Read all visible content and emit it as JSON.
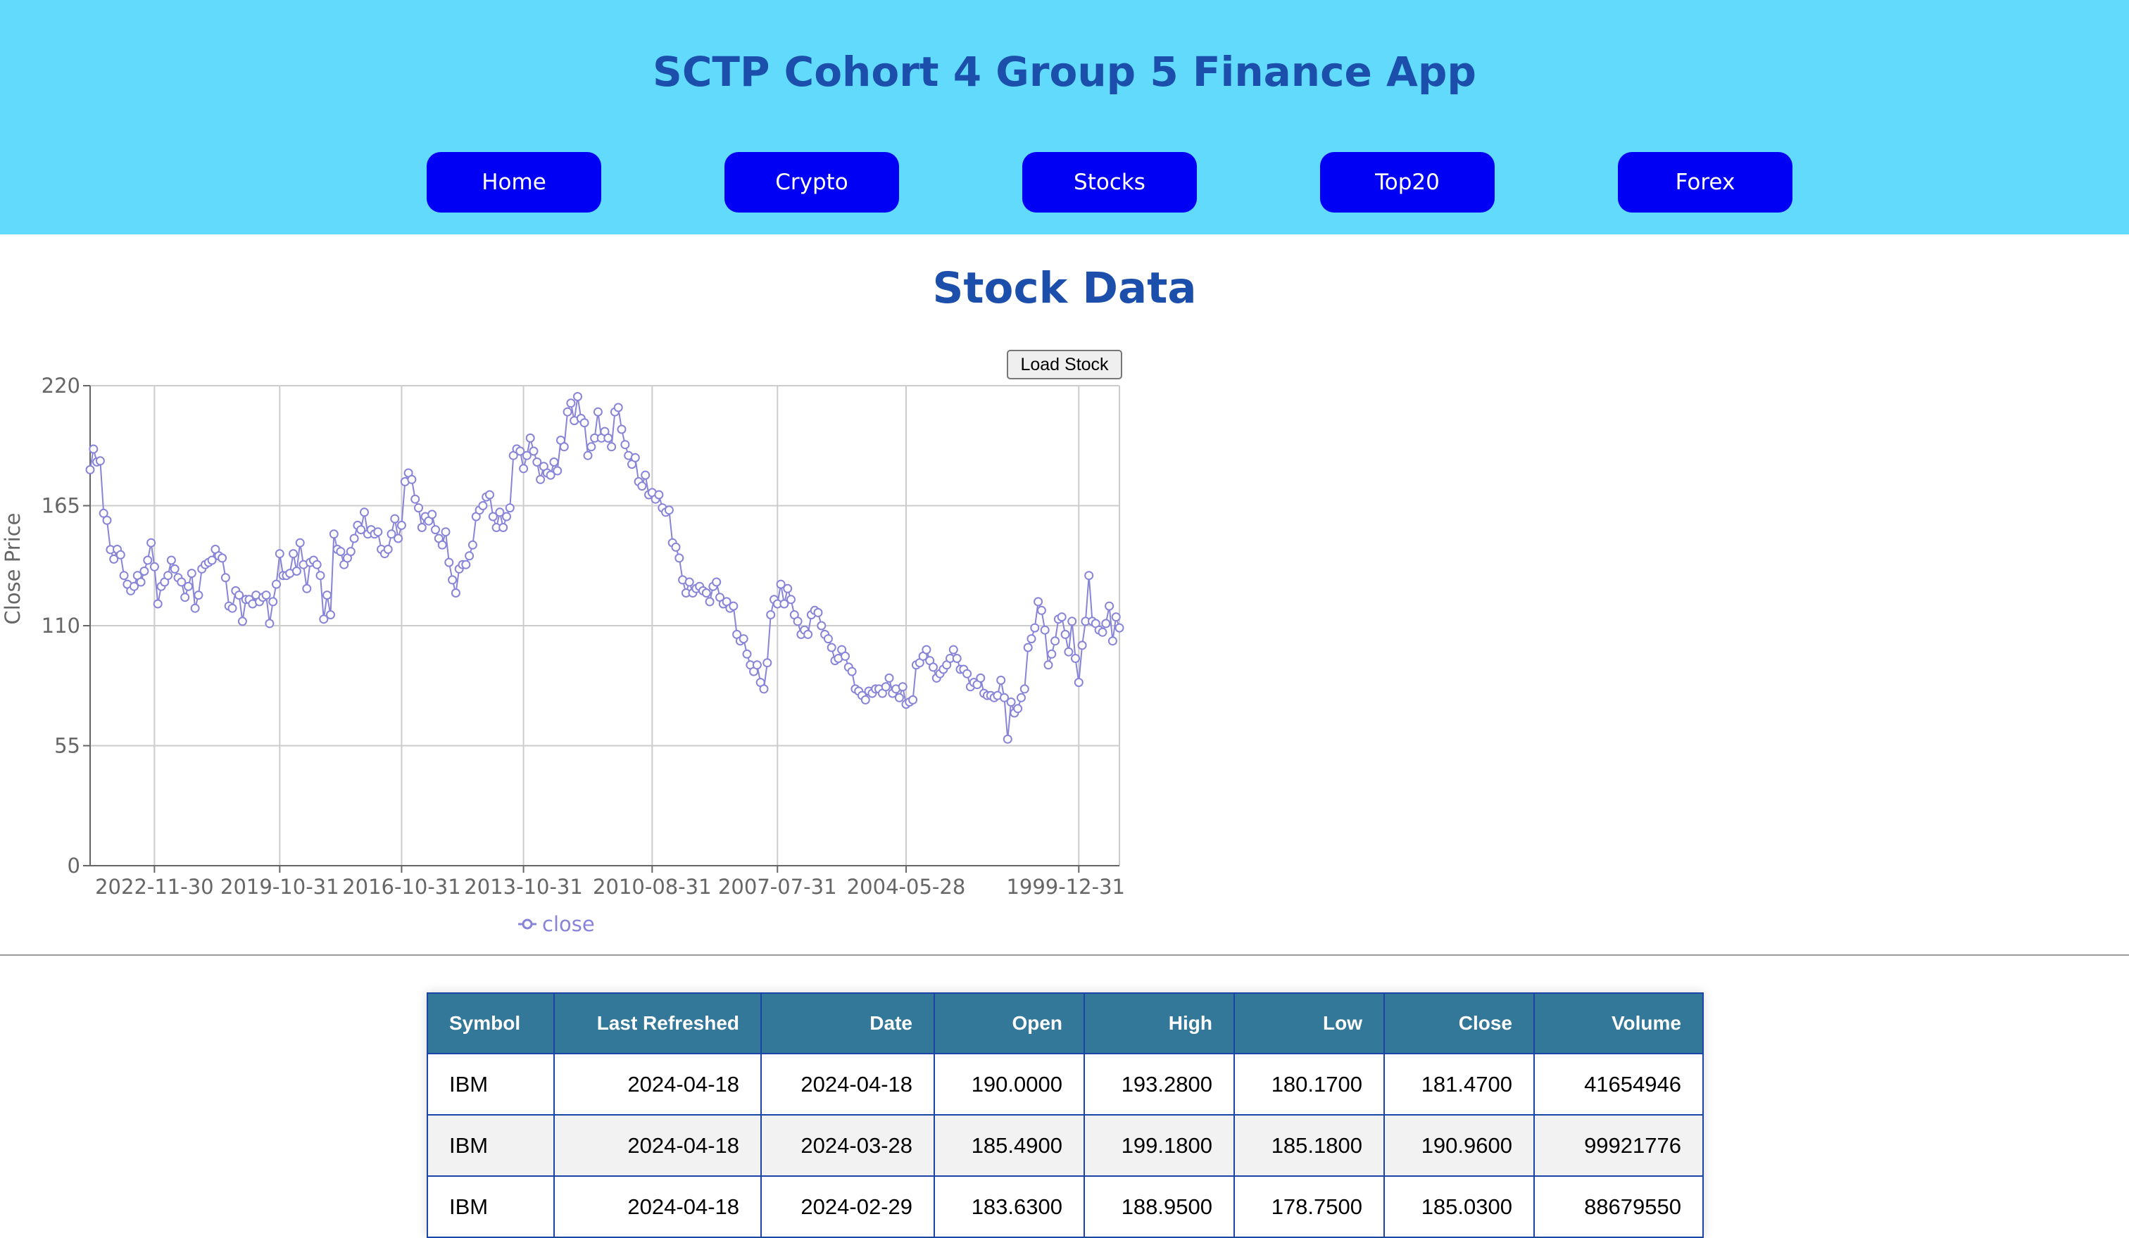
{
  "header": {
    "title": "SCTP Cohort 4 Group 5 Finance App",
    "bg_color": "#61dafb",
    "title_color": "#1b4fab"
  },
  "nav": {
    "button_color": "#0000f5",
    "items": [
      {
        "label": "Home"
      },
      {
        "label": "Crypto"
      },
      {
        "label": "Stocks"
      },
      {
        "label": "Top20"
      },
      {
        "label": "Forex"
      }
    ]
  },
  "page": {
    "title": "Stock Data",
    "load_button": "Load Stock"
  },
  "chart_data": {
    "type": "line",
    "ylabel": "Close Price",
    "xlabel": "",
    "ylim": [
      0,
      220
    ],
    "yticks": [
      0,
      55,
      110,
      165,
      220
    ],
    "x_order": "newest-first",
    "xticks": [
      "2022-11-30",
      "2019-10-31",
      "2016-10-31",
      "2013-10-31",
      "2010-08-31",
      "2007-07-31",
      "2004-05-28",
      "1999-12-31"
    ],
    "grid": true,
    "legend": "bottom-center",
    "series": [
      {
        "name": "close",
        "color": "#8884d8",
        "values": [
          181.47,
          190.96,
          185.03,
          185.54,
          161.5,
          158.3,
          144.87,
          140.5,
          145.0,
          142.5,
          133.0,
          129.0,
          126.0,
          128.0,
          133.0,
          130.0,
          135.0,
          140.0,
          148.0,
          137.0,
          120.0,
          128.0,
          130.0,
          133.0,
          140.0,
          136.0,
          132.0,
          130.0,
          123.0,
          128.0,
          134.0,
          118.0,
          124.0,
          136.0,
          138.0,
          139.0,
          140.0,
          145.0,
          142.0,
          141.0,
          132.0,
          119.0,
          118.0,
          126.0,
          124.0,
          112.0,
          122.0,
          122.0,
          120.0,
          124.0,
          121.0,
          123.0,
          124.0,
          111.0,
          121.0,
          129.0,
          143.0,
          133.0,
          133.0,
          134.0,
          143.0,
          135.0,
          148.0,
          138.0,
          127.0,
          139.0,
          140.0,
          138.0,
          133.0,
          113.0,
          124.0,
          115.0,
          152.0,
          145.0,
          144.0,
          138.0,
          141.0,
          144.0,
          150.0,
          156.0,
          154.0,
          162.0,
          152.0,
          154.0,
          152.0,
          153.0,
          145.0,
          143.0,
          145.0,
          152.0,
          159.0,
          150.0,
          156.0,
          176.0,
          180.0,
          177.0,
          168.0,
          164.0,
          155.0,
          160.0,
          158.0,
          161.0,
          154.0,
          150.0,
          147.0,
          153.0,
          139.0,
          131.0,
          125.0,
          136.0,
          138.0,
          138.0,
          142.0,
          147.0,
          160.0,
          163.0,
          165.0,
          169.0,
          170.0,
          160.0,
          155.0,
          162.0,
          155.0,
          160.0,
          164.0,
          188.0,
          191.0,
          190.0,
          182.0,
          188.0,
          196.0,
          190.0,
          185.0,
          177.0,
          183.0,
          180.0,
          179.0,
          185.0,
          181.0,
          195.0,
          192.0,
          208.0,
          212.0,
          204.0,
          215.0,
          205.0,
          203.0,
          188.0,
          192.0,
          196.0,
          208.0,
          196.0,
          199.0,
          196.0,
          192.0,
          208.0,
          210.0,
          200.0,
          193.0,
          188.0,
          184.0,
          187.0,
          176.0,
          174.0,
          179.0,
          170.0,
          171.0,
          168.0,
          170.0,
          164.0,
          162.0,
          163.0,
          148.0,
          146.0,
          141.0,
          131.0,
          125.0,
          130.0,
          125.0,
          127.0,
          128.0,
          126.0,
          125.0,
          121.0,
          128.0,
          130.0,
          123.0,
          120.0,
          121.0,
          118.0,
          119.0,
          106.0,
          103.0,
          104.0,
          97.0,
          92.0,
          89.0,
          92.0,
          84.0,
          81.0,
          93.0,
          115.0,
          122.0,
          120.0,
          129.0,
          120.0,
          127.0,
          122.0,
          115.0,
          112.0,
          106.0,
          108.0,
          106.0,
          115.0,
          117.0,
          116.0,
          110.0,
          106.0,
          104.0,
          100.0,
          94.0,
          95.0,
          99.0,
          96.0,
          91.0,
          89.0,
          81.0,
          80.0,
          78.0,
          76.0,
          80.0,
          79.0,
          81.0,
          81.0,
          79.0,
          82.0,
          86.0,
          79.0,
          81.0,
          77.0,
          82.0,
          74.0,
          75.0,
          76.0,
          92.0,
          93.0,
          96.0,
          99.0,
          94.0,
          91.0,
          86.0,
          88.0,
          90.0,
          92.0,
          95.0,
          99.0,
          95.0,
          90.0,
          90.0,
          88.0,
          82.0,
          84.0,
          83.0,
          86.0,
          79.0,
          78.0,
          78.0,
          77.0,
          78.0,
          85.0,
          77.0,
          58.0,
          75.0,
          70.0,
          72.0,
          77.0,
          81.0,
          100.0,
          104.0,
          109.0,
          121.0,
          117.0,
          108.0,
          92.0,
          97.0,
          103.0,
          113.0,
          114.0,
          106.0,
          98.0,
          112.0,
          95.0,
          84.0,
          101.0,
          112.0,
          133.0,
          112.0,
          111.0,
          108.0,
          107.0,
          111.0,
          119.0,
          103.0,
          114.0,
          109.0
        ]
      }
    ]
  },
  "table": {
    "header_bg": "#337799",
    "columns": [
      "Symbol",
      "Last Refreshed",
      "Date",
      "Open",
      "High",
      "Low",
      "Close",
      "Volume"
    ],
    "rows": [
      [
        "IBM",
        "2024-04-18",
        "2024-04-18",
        "190.0000",
        "193.2800",
        "180.1700",
        "181.4700",
        "41654946"
      ],
      [
        "IBM",
        "2024-04-18",
        "2024-03-28",
        "185.4900",
        "199.1800",
        "185.1800",
        "190.9600",
        "99921776"
      ],
      [
        "IBM",
        "2024-04-18",
        "2024-02-29",
        "183.6300",
        "188.9500",
        "178.7500",
        "185.0300",
        "88679550"
      ]
    ]
  }
}
